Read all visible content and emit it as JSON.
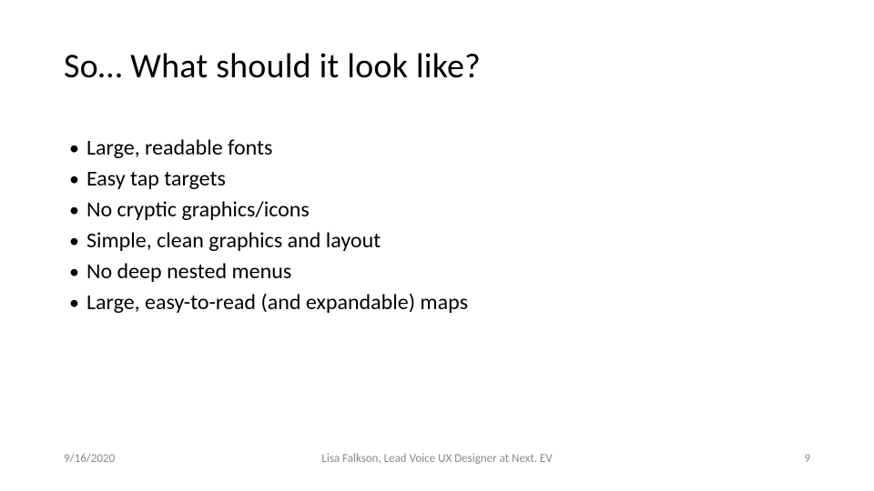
{
  "slide": {
    "title": "So… What should it look like?",
    "bullets": [
      "Large, readable fonts",
      "Easy tap targets",
      "No cryptic graphics/icons",
      "Simple, clean graphics and layout",
      "No deep nested menus",
      "Large, easy-to-read (and expandable) maps"
    ]
  },
  "footer": {
    "date": "9/16/2020",
    "author": "Lisa Falkson, Lead Voice UX Designer at Next. EV",
    "page": "9"
  }
}
